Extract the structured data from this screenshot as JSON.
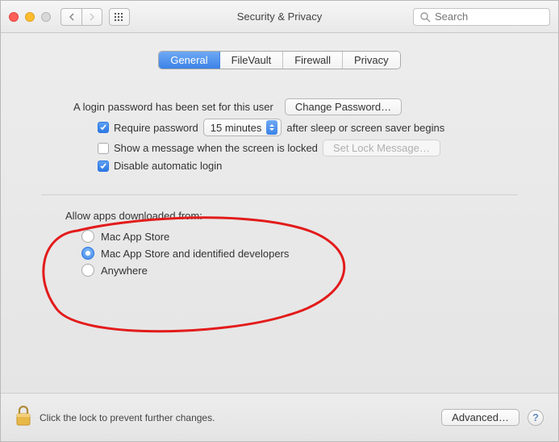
{
  "window": {
    "title": "Security & Privacy",
    "search_placeholder": "Search"
  },
  "tabs": {
    "general": "General",
    "filevault": "FileVault",
    "firewall": "Firewall",
    "privacy": "Privacy"
  },
  "login": {
    "password_set_text": "A login password has been set for this user",
    "change_password_btn": "Change Password…",
    "require_password_label": "Require password",
    "require_password_delay": "15 minutes",
    "require_password_tail": "after sleep or screen saver begins",
    "show_message_label": "Show a message when the screen is locked",
    "set_lock_message_btn": "Set Lock Message…",
    "disable_auto_login_label": "Disable automatic login"
  },
  "allow": {
    "heading": "Allow apps downloaded from:",
    "opt_mac_app_store": "Mac App Store",
    "opt_identified": "Mac App Store and identified developers",
    "opt_anywhere": "Anywhere"
  },
  "footer": {
    "lock_text": "Click the lock to prevent further changes.",
    "advanced_btn": "Advanced…",
    "help": "?"
  }
}
